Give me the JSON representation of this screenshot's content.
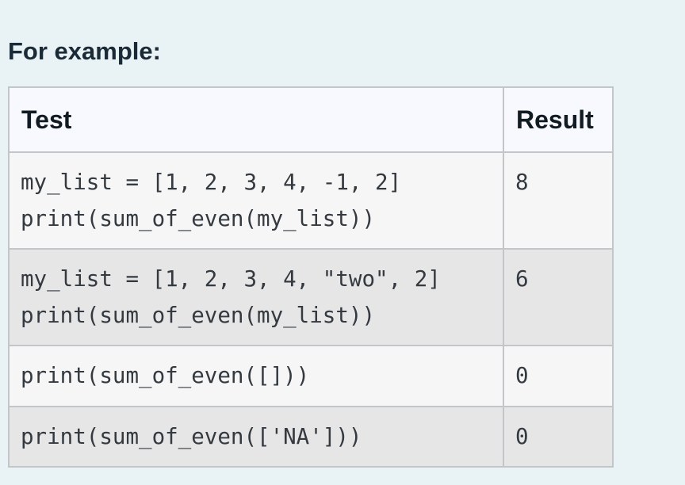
{
  "heading": "For example:",
  "table": {
    "headers": {
      "test": "Test",
      "result": "Result"
    },
    "rows": [
      {
        "test_lines": [
          "my_list = [1, 2, 3, 4, -1, 2]",
          "print(sum_of_even(my_list))"
        ],
        "result": "8"
      },
      {
        "test_lines": [
          "my_list = [1, 2, 3, 4, \"two\", 2]",
          "print(sum_of_even(my_list))"
        ],
        "result": "6"
      },
      {
        "test_lines": [
          "print(sum_of_even([]))"
        ],
        "result": "0"
      },
      {
        "test_lines": [
          "print(sum_of_even(['NA']))"
        ],
        "result": "0"
      }
    ]
  }
}
